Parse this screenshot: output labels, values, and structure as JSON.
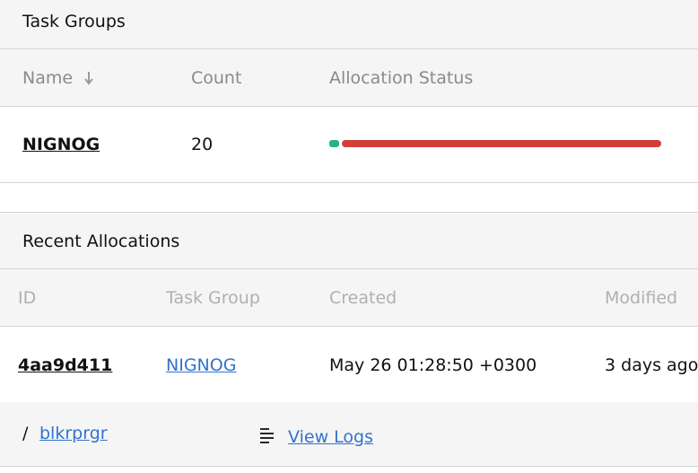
{
  "task_groups": {
    "title": "Task Groups",
    "columns": {
      "name": "Name",
      "sort_icon": "sort-arrow-down-icon",
      "count": "Count",
      "status": "Allocation Status"
    },
    "rows": [
      {
        "name": "NIGNOG",
        "count": "20",
        "status_fractions": {
          "running": 0.03,
          "failed": 0.97
        }
      }
    ],
    "colors": {
      "running": "#25b584",
      "failed": "#d0403a"
    }
  },
  "recent_allocations": {
    "title": "Recent Allocations",
    "columns": {
      "id": "ID",
      "task_group": "Task Group",
      "created": "Created",
      "modified": "Modified"
    },
    "rows": [
      {
        "id": "4aa9d411",
        "task_group": "NIGNOG",
        "created": "May 26 01:28:50 +0300",
        "modified": "3 days ago",
        "task": {
          "separator": "/",
          "name": "blkrprgr",
          "logs_icon": "logs-icon",
          "logs_label": "View Logs"
        }
      }
    ]
  }
}
